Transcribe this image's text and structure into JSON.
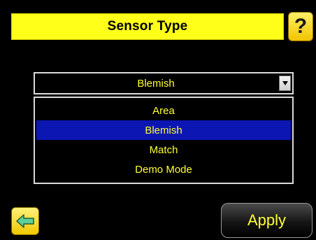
{
  "header": {
    "title": "Sensor Type",
    "help_glyph": "?"
  },
  "sensor_select": {
    "selected_value": "Blemish",
    "options": [
      "Area",
      "Blemish",
      "Match",
      "Demo Mode"
    ],
    "highlighted_option": "Blemish"
  },
  "footer": {
    "back_icon": "back-arrow-icon",
    "apply_label": "Apply"
  },
  "colors": {
    "header_bg": "#ffff1a",
    "text_yellow": "#ffff33",
    "selection_blue": "#0b16b3",
    "background": "#000000"
  }
}
